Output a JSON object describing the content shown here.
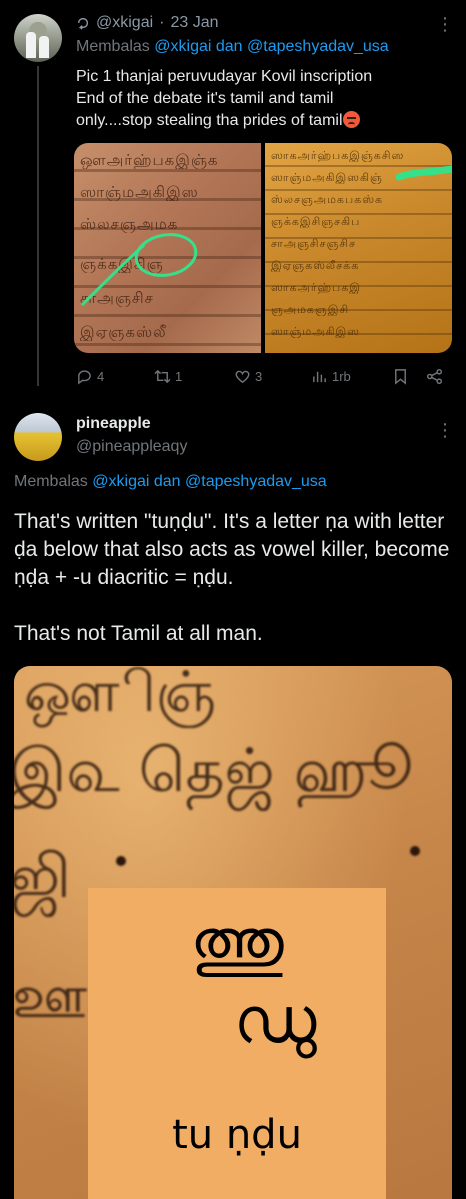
{
  "tweet1": {
    "handle": "@xkigai",
    "separator": "·",
    "date": "23 Jan",
    "replying_prefix": "Membalas",
    "replying_user1": "@xkigai",
    "replying_conj": "dan",
    "replying_user2": "@tapeshyadav_usa",
    "text_lines": [
      "Pic 1 thanjai peruvudayar Kovil inscription",
      "End of the debate it's tamil and tamil",
      "only....stop stealing tha prides of tamil"
    ],
    "left_image_script": [
      "ஔஅர்ஹ்பகஇஞ்க",
      "ஸாஞ்மஅகிஇஸ",
      "ஸ்லசஞஅமக",
      "ஞக்கஇசிஞ",
      "சாஅஞசிச",
      "இஏஞகஸ்லீ"
    ],
    "right_image_script": [
      "ஸாகஅர்ஹ்பகஇஞ்கசிஸ",
      "ஸாஞ்மஅகிஇஸகிஞ்",
      "ஸ்லசஞஅமகபகஸ்க",
      "ஞக்கஇசிஞசகிப",
      "சாஅஞசிசஞசிச",
      "இஏஞகஸ்லீசக்க",
      "ஸாகஅர்ஹ்பகஇ",
      "ஞஅமகஞஇசி",
      "ஸாஞ்மஅகிஇஸ"
    ],
    "stats": {
      "replies": "4",
      "reposts": "1",
      "likes": "3",
      "views": "1rb"
    }
  },
  "tweet2": {
    "name": "pineapple",
    "handle": "@pineappleaqy",
    "replying_prefix": "Membalas",
    "replying_user1": "@xkigai",
    "replying_conj": "dan",
    "replying_user2": "@tapeshyadav_usa",
    "para1": "That's written \"tuṇḍu\". It's a letter ṇa with letter ḍa below that also acts as vowel killer, become ṇḍa + -u diacritic = ṇḍu.",
    "para2": "That's not Tamil at all man.",
    "image_script_row1": "ஔிஞ்",
    "image_script_row2": "இ௳ தெஜ் ஹூ",
    "image_script_row3": "ஜி",
    "image_script_row4": "ஊஅ",
    "inset_glyph": "ത്തു",
    "inset_glyph2": "ഡു",
    "inset_label": "tu  ṇḍu"
  },
  "colors": {
    "background": "#000000",
    "text": "#e7e9ea",
    "muted": "#71767b",
    "link": "#1d9bf0",
    "annotation": "#35e08a"
  },
  "icons": [
    "thread-reply-icon",
    "more-icon",
    "reply-icon",
    "repost-icon",
    "like-icon",
    "views-icon",
    "bookmark-icon",
    "share-icon"
  ]
}
